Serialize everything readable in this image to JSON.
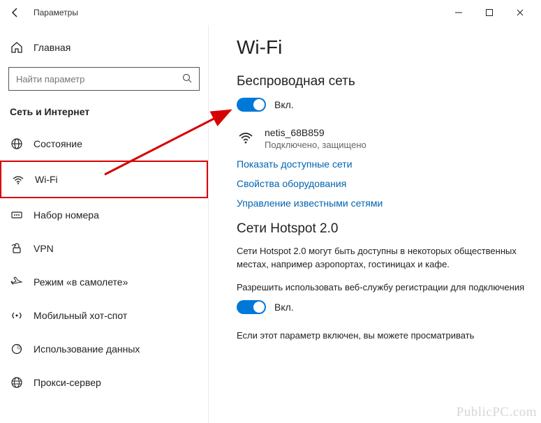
{
  "titlebar": {
    "title": "Параметры"
  },
  "sidebar": {
    "home_label": "Главная",
    "search_placeholder": "Найти параметр",
    "section_head": "Сеть и Интернет",
    "items": [
      {
        "label": "Состояние",
        "icon": "globe"
      },
      {
        "label": "Wi-Fi",
        "icon": "wifi",
        "selected": true
      },
      {
        "label": "Набор номера",
        "icon": "dialup"
      },
      {
        "label": "VPN",
        "icon": "vpn"
      },
      {
        "label": "Режим «в самолете»",
        "icon": "airplane"
      },
      {
        "label": "Мобильный хот-спот",
        "icon": "hotspot"
      },
      {
        "label": "Использование данных",
        "icon": "datausage"
      },
      {
        "label": "Прокси-сервер",
        "icon": "proxy"
      }
    ]
  },
  "content": {
    "page_title": "Wi-Fi",
    "wireless": {
      "heading": "Беспроводная сеть",
      "toggle_label": "Вкл.",
      "network_name": "netis_68B859",
      "network_status": "Подключено, защищено"
    },
    "links": {
      "show_available": "Показать доступные сети",
      "hardware_props": "Свойства оборудования",
      "manage_known": "Управление известными сетями"
    },
    "hotspot2": {
      "heading": "Сети Hotspot 2.0",
      "desc": "Сети Hotspot 2.0 могут быть доступны в некоторых общественных местах, например аэропортах, гостиницах и кафе.",
      "allow_label": "Разрешить использовать веб-службу регистрации для подключения",
      "toggle_label": "Вкл.",
      "note": "Если этот параметр включен, вы можете просматривать"
    }
  },
  "watermark": "PublicPC.com"
}
